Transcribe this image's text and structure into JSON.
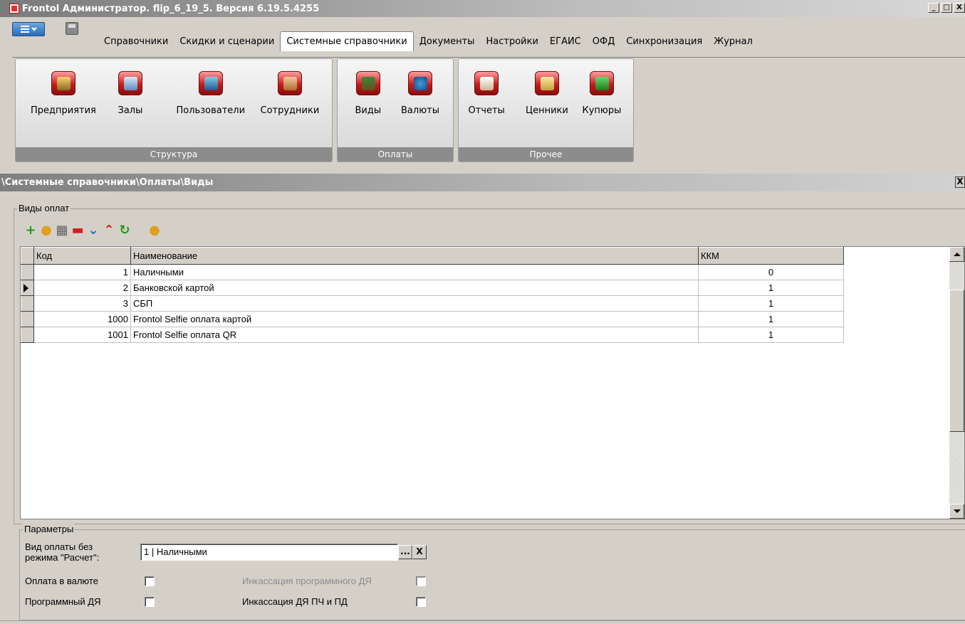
{
  "window": {
    "title": "Frontol Администратор. flip_6_19_5. Версия 6.19.5.4255",
    "minimize": "_",
    "maximize": "□",
    "close": "X"
  },
  "menu_tabs": [
    {
      "label": "Справочники"
    },
    {
      "label": "Скидки и сценарии"
    },
    {
      "label": "Системные справочники",
      "active": true
    },
    {
      "label": "Документы"
    },
    {
      "label": "Настройки"
    },
    {
      "label": "ЕГАИС"
    },
    {
      "label": "ОФД"
    },
    {
      "label": "Синхронизация"
    },
    {
      "label": "Журнал"
    }
  ],
  "ribbon": {
    "groups": [
      {
        "label": "Структура",
        "buttons": [
          {
            "label": "Предприятия",
            "icon": "enterprise-icon"
          },
          {
            "label": "Залы",
            "icon": "halls-icon"
          },
          {
            "label": "Пользователи",
            "icon": "users-icon"
          },
          {
            "label": "Сотрудники",
            "icon": "employees-icon"
          }
        ]
      },
      {
        "label": "Оплаты",
        "buttons": [
          {
            "label": "Виды",
            "icon": "wallet-icon"
          },
          {
            "label": "Валюты",
            "icon": "dollar-icon"
          }
        ]
      },
      {
        "label": "Прочее",
        "buttons": [
          {
            "label": "Отчеты",
            "icon": "reports-icon"
          },
          {
            "label": "Ценники",
            "icon": "price-tags-icon"
          },
          {
            "label": "Купюры",
            "icon": "banknote-icon"
          }
        ]
      }
    ]
  },
  "panel": {
    "path": "\\Системные справочники\\Оплаты\\Виды",
    "close": "X"
  },
  "payment_types": {
    "legend": "Виды оплат",
    "toolbar": [
      {
        "name": "add-icon",
        "glyph": "+",
        "color": "#1e9c1e"
      },
      {
        "name": "edit-icon",
        "glyph": "●",
        "color": "#e0a020"
      },
      {
        "name": "copy-icon",
        "glyph": "▦",
        "color": "#606060"
      },
      {
        "name": "delete-icon",
        "glyph": "▬",
        "color": "#d02020"
      },
      {
        "name": "move-down-icon",
        "glyph": "⌄",
        "color": "#2060d0"
      },
      {
        "name": "move-up-icon",
        "glyph": "⌃",
        "color": "#d02020"
      },
      {
        "name": "refresh-icon",
        "glyph": "↻",
        "color": "#1e9c1e"
      },
      {
        "name": "clear-icon",
        "glyph": "●",
        "color": "#e0a020"
      }
    ],
    "columns": [
      "Код",
      "Наименование",
      "ККМ"
    ],
    "rows": [
      {
        "code": "1",
        "name": "Наличными",
        "kkm": "0"
      },
      {
        "code": "2",
        "name": "Банковской картой",
        "kkm": "1"
      },
      {
        "code": "3",
        "name": "СБП",
        "kkm": "1"
      },
      {
        "code": "1000",
        "name": "Frontol Selfie оплата картой",
        "kkm": "1"
      },
      {
        "code": "1001",
        "name": "Frontol Selfie оплата QR",
        "kkm": "1"
      }
    ],
    "current_row": 2
  },
  "params": {
    "legend": "Параметры",
    "payment_without_calc_label_1": "Вид оплаты без",
    "payment_without_calc_label_2": "режима \"Расчет\":",
    "payment_without_calc_value": "1 | Наличными",
    "browse_button": "...",
    "clear_button": "X",
    "currency_payment_label": "Оплата в валюте",
    "program_dya_label": "Программный ДЯ",
    "encash_program_label": "Инкассация программного ДЯ",
    "encash_dya_label": "Инкассация ДЯ ПЧ и ПД"
  }
}
